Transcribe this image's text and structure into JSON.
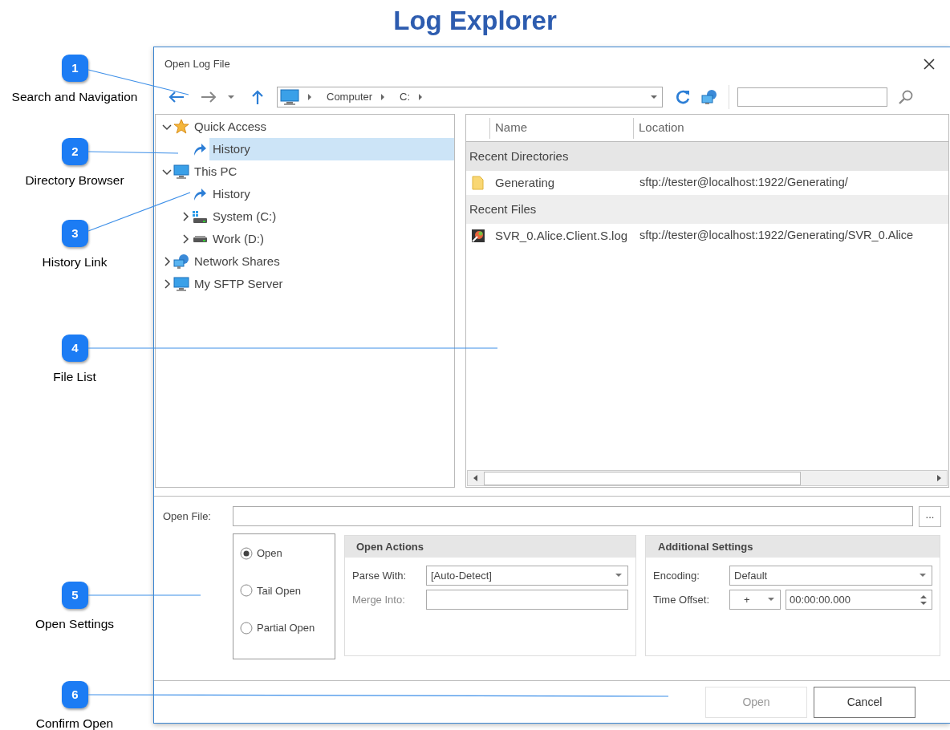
{
  "page_title": "Log Explorer",
  "callouts": [
    {
      "number": "1",
      "label": "Search and Navigation"
    },
    {
      "number": "2",
      "label": "Directory Browser"
    },
    {
      "number": "3",
      "label": "History Link"
    },
    {
      "number": "4",
      "label": "File List"
    },
    {
      "number": "5",
      "label": "Open Settings"
    },
    {
      "number": "6",
      "label": "Confirm Open"
    }
  ],
  "dialog": {
    "title": "Open Log File",
    "address": [
      "Computer",
      "C:"
    ],
    "tree": [
      {
        "kind": "star",
        "label": "Quick Access",
        "expanded": true,
        "selected": false,
        "children": [
          {
            "kind": "history",
            "label": "History",
            "selected": true
          }
        ]
      },
      {
        "kind": "monitor",
        "label": "This PC",
        "expanded": true,
        "selected": false,
        "children": [
          {
            "kind": "history",
            "label": "History",
            "selected": false
          },
          {
            "kind": "system-drive",
            "label": "System (C:)",
            "expanded": false,
            "selected": false
          },
          {
            "kind": "drive",
            "label": "Work (D:)",
            "expanded": false,
            "selected": false
          }
        ]
      },
      {
        "kind": "network",
        "label": "Network Shares",
        "expanded": false,
        "selected": false
      },
      {
        "kind": "monitor",
        "label": "My SFTP Server",
        "expanded": false,
        "selected": false
      }
    ],
    "file_list": {
      "columns": [
        "Name",
        "Location"
      ],
      "groups": [
        {
          "label": "Recent Directories",
          "rows": [
            {
              "kind": "folder",
              "name": "Generating",
              "location": "sftp://tester@localhost:1922/Generating/"
            }
          ]
        },
        {
          "label": "Recent Files",
          "rows": [
            {
              "kind": "log",
              "name": "SVR_0.Alice.Client.S.log",
              "location": "sftp://tester@localhost:1922/Generating/SVR_0.Alice"
            }
          ]
        }
      ]
    },
    "open_file": {
      "label": "Open File:",
      "browse": "..."
    },
    "open_modes": [
      {
        "label": "Open",
        "selected": true
      },
      {
        "label": "Tail Open",
        "selected": false
      },
      {
        "label": "Partial Open",
        "selected": false
      }
    ],
    "open_actions": {
      "title": "Open Actions",
      "fields": [
        {
          "kind": "dropdown",
          "label": "Parse With:",
          "value": "[Auto-Detect]",
          "disabled": false
        },
        {
          "kind": "text",
          "label": "Merge Into:",
          "disabled": true
        }
      ]
    },
    "additional_settings": {
      "title": "Additional Settings",
      "encoding_label": "Encoding:",
      "encoding": "Default",
      "time_offset_label": "Time Offset:",
      "sign": "+",
      "time_offset": "00:00:00.000"
    },
    "buttons": [
      {
        "label": "Open",
        "disabled": true
      },
      {
        "label": "Cancel",
        "disabled": false
      }
    ]
  }
}
